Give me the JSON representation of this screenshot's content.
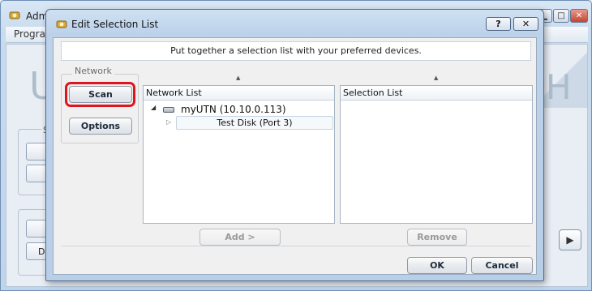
{
  "main_window": {
    "title": "Adm",
    "menu_program": "Program",
    "banner_left": "U",
    "banner_right": "H",
    "group_label": "S",
    "button_d": "D",
    "arrow_button": "▶"
  },
  "dialog": {
    "title": "Edit Selection List",
    "help_button": "?",
    "close_button": "✕",
    "instruction": "Put together a selection list with your preferred devices.",
    "network_group": {
      "label": "Network",
      "scan_button": "Scan",
      "options_button": "Options"
    },
    "network_list": {
      "header": "Network List",
      "tree": {
        "root_toggle": "◢",
        "root_label": "myUTN (10.10.0.113)",
        "child_toggle": "▷",
        "child_label": "Test Disk (Port 3)"
      }
    },
    "selection_list": {
      "header": "Selection List"
    },
    "sort_caret": "▲",
    "add_button": "Add >",
    "remove_button": "Remove",
    "ok_button": "OK",
    "cancel_button": "Cancel"
  },
  "colors": {
    "highlight": "#e0141e",
    "title_bar": "#bcd2ea"
  }
}
